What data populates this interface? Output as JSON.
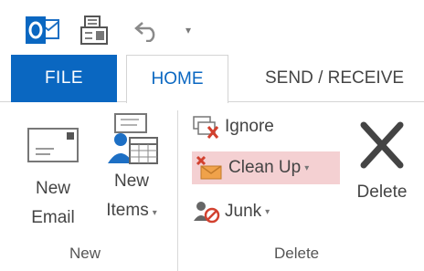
{
  "qat": {
    "app_icon": "outlook-icon",
    "save_icon": "send-receive-all-icon",
    "undo_icon": "undo-icon",
    "customize_glyph": "▾"
  },
  "tabs": [
    {
      "label": "FILE"
    },
    {
      "label": "HOME"
    },
    {
      "label": "SEND / RECEIVE"
    }
  ],
  "ribbon": {
    "new_group": {
      "label": "New",
      "new_email_line1": "New",
      "new_email_line2": "Email",
      "new_items_line1": "New",
      "new_items_line2": "Items",
      "new_items_caret": "▾"
    },
    "delete_group": {
      "label": "Delete",
      "ignore": "Ignore",
      "clean_up": "Clean Up",
      "clean_up_caret": "▾",
      "junk": "Junk",
      "junk_caret": "▾",
      "delete": "Delete"
    }
  },
  "colors": {
    "file_tab": "#0a67c1",
    "accent_text": "#0a67c1",
    "highlight": "#f4d0d2",
    "delete_x": "#444444"
  }
}
